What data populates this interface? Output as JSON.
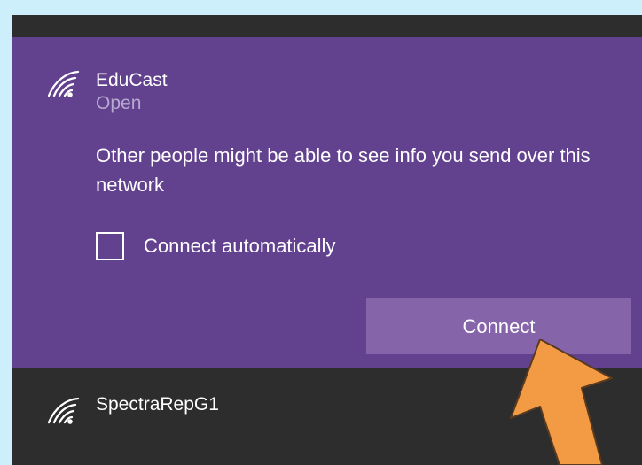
{
  "networks": {
    "selected": {
      "name": "EduCast",
      "status": "Open",
      "warning": "Other people might be able to see info you send over this network",
      "auto_connect_label": "Connect automatically",
      "auto_connect_checked": false,
      "connect_button_label": "Connect"
    },
    "other": [
      {
        "name": "SpectraRepG1"
      }
    ]
  },
  "icons": {
    "wifi": "wifi-signal-icon",
    "arrow": "orange-arrow-icon"
  },
  "colors": {
    "selected_background": "#62418f",
    "button_background": "#8564aa",
    "list_background": "#2d2d2d",
    "status_text": "#b7a8cf",
    "arrow_fill": "#f39a44"
  }
}
